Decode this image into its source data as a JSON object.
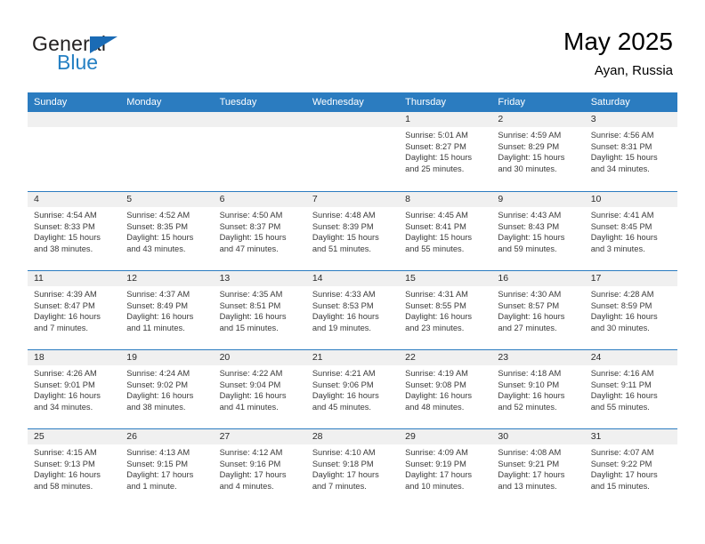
{
  "brand": {
    "name_top": "General",
    "name_bottom": "Blue"
  },
  "header": {
    "title": "May 2025",
    "location": "Ayan, Russia"
  },
  "colors": {
    "header_blue": "#2b7cc0",
    "brand_blue": "#2580c3",
    "day_band_gray": "#f0f0f0"
  },
  "weekdays": [
    "Sunday",
    "Monday",
    "Tuesday",
    "Wednesday",
    "Thursday",
    "Friday",
    "Saturday"
  ],
  "weeks": [
    [
      {
        "day": "",
        "sunrise": "",
        "sunset": "",
        "daylight_line1": "",
        "daylight_line2": ""
      },
      {
        "day": "",
        "sunrise": "",
        "sunset": "",
        "daylight_line1": "",
        "daylight_line2": ""
      },
      {
        "day": "",
        "sunrise": "",
        "sunset": "",
        "daylight_line1": "",
        "daylight_line2": ""
      },
      {
        "day": "",
        "sunrise": "",
        "sunset": "",
        "daylight_line1": "",
        "daylight_line2": ""
      },
      {
        "day": "1",
        "sunrise": "Sunrise: 5:01 AM",
        "sunset": "Sunset: 8:27 PM",
        "daylight_line1": "Daylight: 15 hours",
        "daylight_line2": "and 25 minutes."
      },
      {
        "day": "2",
        "sunrise": "Sunrise: 4:59 AM",
        "sunset": "Sunset: 8:29 PM",
        "daylight_line1": "Daylight: 15 hours",
        "daylight_line2": "and 30 minutes."
      },
      {
        "day": "3",
        "sunrise": "Sunrise: 4:56 AM",
        "sunset": "Sunset: 8:31 PM",
        "daylight_line1": "Daylight: 15 hours",
        "daylight_line2": "and 34 minutes."
      }
    ],
    [
      {
        "day": "4",
        "sunrise": "Sunrise: 4:54 AM",
        "sunset": "Sunset: 8:33 PM",
        "daylight_line1": "Daylight: 15 hours",
        "daylight_line2": "and 38 minutes."
      },
      {
        "day": "5",
        "sunrise": "Sunrise: 4:52 AM",
        "sunset": "Sunset: 8:35 PM",
        "daylight_line1": "Daylight: 15 hours",
        "daylight_line2": "and 43 minutes."
      },
      {
        "day": "6",
        "sunrise": "Sunrise: 4:50 AM",
        "sunset": "Sunset: 8:37 PM",
        "daylight_line1": "Daylight: 15 hours",
        "daylight_line2": "and 47 minutes."
      },
      {
        "day": "7",
        "sunrise": "Sunrise: 4:48 AM",
        "sunset": "Sunset: 8:39 PM",
        "daylight_line1": "Daylight: 15 hours",
        "daylight_line2": "and 51 minutes."
      },
      {
        "day": "8",
        "sunrise": "Sunrise: 4:45 AM",
        "sunset": "Sunset: 8:41 PM",
        "daylight_line1": "Daylight: 15 hours",
        "daylight_line2": "and 55 minutes."
      },
      {
        "day": "9",
        "sunrise": "Sunrise: 4:43 AM",
        "sunset": "Sunset: 8:43 PM",
        "daylight_line1": "Daylight: 15 hours",
        "daylight_line2": "and 59 minutes."
      },
      {
        "day": "10",
        "sunrise": "Sunrise: 4:41 AM",
        "sunset": "Sunset: 8:45 PM",
        "daylight_line1": "Daylight: 16 hours",
        "daylight_line2": "and 3 minutes."
      }
    ],
    [
      {
        "day": "11",
        "sunrise": "Sunrise: 4:39 AM",
        "sunset": "Sunset: 8:47 PM",
        "daylight_line1": "Daylight: 16 hours",
        "daylight_line2": "and 7 minutes."
      },
      {
        "day": "12",
        "sunrise": "Sunrise: 4:37 AM",
        "sunset": "Sunset: 8:49 PM",
        "daylight_line1": "Daylight: 16 hours",
        "daylight_line2": "and 11 minutes."
      },
      {
        "day": "13",
        "sunrise": "Sunrise: 4:35 AM",
        "sunset": "Sunset: 8:51 PM",
        "daylight_line1": "Daylight: 16 hours",
        "daylight_line2": "and 15 minutes."
      },
      {
        "day": "14",
        "sunrise": "Sunrise: 4:33 AM",
        "sunset": "Sunset: 8:53 PM",
        "daylight_line1": "Daylight: 16 hours",
        "daylight_line2": "and 19 minutes."
      },
      {
        "day": "15",
        "sunrise": "Sunrise: 4:31 AM",
        "sunset": "Sunset: 8:55 PM",
        "daylight_line1": "Daylight: 16 hours",
        "daylight_line2": "and 23 minutes."
      },
      {
        "day": "16",
        "sunrise": "Sunrise: 4:30 AM",
        "sunset": "Sunset: 8:57 PM",
        "daylight_line1": "Daylight: 16 hours",
        "daylight_line2": "and 27 minutes."
      },
      {
        "day": "17",
        "sunrise": "Sunrise: 4:28 AM",
        "sunset": "Sunset: 8:59 PM",
        "daylight_line1": "Daylight: 16 hours",
        "daylight_line2": "and 30 minutes."
      }
    ],
    [
      {
        "day": "18",
        "sunrise": "Sunrise: 4:26 AM",
        "sunset": "Sunset: 9:01 PM",
        "daylight_line1": "Daylight: 16 hours",
        "daylight_line2": "and 34 minutes."
      },
      {
        "day": "19",
        "sunrise": "Sunrise: 4:24 AM",
        "sunset": "Sunset: 9:02 PM",
        "daylight_line1": "Daylight: 16 hours",
        "daylight_line2": "and 38 minutes."
      },
      {
        "day": "20",
        "sunrise": "Sunrise: 4:22 AM",
        "sunset": "Sunset: 9:04 PM",
        "daylight_line1": "Daylight: 16 hours",
        "daylight_line2": "and 41 minutes."
      },
      {
        "day": "21",
        "sunrise": "Sunrise: 4:21 AM",
        "sunset": "Sunset: 9:06 PM",
        "daylight_line1": "Daylight: 16 hours",
        "daylight_line2": "and 45 minutes."
      },
      {
        "day": "22",
        "sunrise": "Sunrise: 4:19 AM",
        "sunset": "Sunset: 9:08 PM",
        "daylight_line1": "Daylight: 16 hours",
        "daylight_line2": "and 48 minutes."
      },
      {
        "day": "23",
        "sunrise": "Sunrise: 4:18 AM",
        "sunset": "Sunset: 9:10 PM",
        "daylight_line1": "Daylight: 16 hours",
        "daylight_line2": "and 52 minutes."
      },
      {
        "day": "24",
        "sunrise": "Sunrise: 4:16 AM",
        "sunset": "Sunset: 9:11 PM",
        "daylight_line1": "Daylight: 16 hours",
        "daylight_line2": "and 55 minutes."
      }
    ],
    [
      {
        "day": "25",
        "sunrise": "Sunrise: 4:15 AM",
        "sunset": "Sunset: 9:13 PM",
        "daylight_line1": "Daylight: 16 hours",
        "daylight_line2": "and 58 minutes."
      },
      {
        "day": "26",
        "sunrise": "Sunrise: 4:13 AM",
        "sunset": "Sunset: 9:15 PM",
        "daylight_line1": "Daylight: 17 hours",
        "daylight_line2": "and 1 minute."
      },
      {
        "day": "27",
        "sunrise": "Sunrise: 4:12 AM",
        "sunset": "Sunset: 9:16 PM",
        "daylight_line1": "Daylight: 17 hours",
        "daylight_line2": "and 4 minutes."
      },
      {
        "day": "28",
        "sunrise": "Sunrise: 4:10 AM",
        "sunset": "Sunset: 9:18 PM",
        "daylight_line1": "Daylight: 17 hours",
        "daylight_line2": "and 7 minutes."
      },
      {
        "day": "29",
        "sunrise": "Sunrise: 4:09 AM",
        "sunset": "Sunset: 9:19 PM",
        "daylight_line1": "Daylight: 17 hours",
        "daylight_line2": "and 10 minutes."
      },
      {
        "day": "30",
        "sunrise": "Sunrise: 4:08 AM",
        "sunset": "Sunset: 9:21 PM",
        "daylight_line1": "Daylight: 17 hours",
        "daylight_line2": "and 13 minutes."
      },
      {
        "day": "31",
        "sunrise": "Sunrise: 4:07 AM",
        "sunset": "Sunset: 9:22 PM",
        "daylight_line1": "Daylight: 17 hours",
        "daylight_line2": "and 15 minutes."
      }
    ]
  ]
}
